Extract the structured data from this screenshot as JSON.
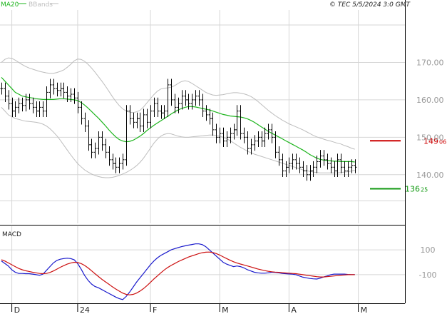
{
  "header": {
    "legend_ma": "MA20",
    "legend_bb": "BBands",
    "copyright": "© TEC 5/5/2024 3:0 GMT"
  },
  "colors": {
    "price_bar": "#000000",
    "ma": "#1db51d",
    "bbands": "#bdbdbd",
    "grid": "#d6d6d6",
    "resistance": "#cc0000",
    "support": "#119911",
    "macd": "#1a1acc",
    "signal": "#cc1111",
    "axis_text": "#999999"
  },
  "chart_data": [
    {
      "type": "ohlc",
      "y_ticks": [
        {
          "value": 170,
          "label": "170.00"
        },
        {
          "value": 160,
          "label": "160.00"
        },
        {
          "value": 150,
          "label": "150.00"
        },
        {
          "value": 140,
          "label": "140.00"
        }
      ],
      "ylim": [
        127,
        184
      ],
      "x_ticks": [
        {
          "index": 3,
          "label": "D"
        },
        {
          "index": 22,
          "label": "24"
        },
        {
          "index": 43,
          "label": "F"
        },
        {
          "index": 63,
          "label": "M"
        },
        {
          "index": 83,
          "label": "A"
        },
        {
          "index": 103,
          "label": "M"
        }
      ],
      "levels": [
        {
          "name": "resistance",
          "value": 149.06,
          "label_main": "149",
          "label_frac": "06"
        },
        {
          "name": "support",
          "value": 136.25,
          "label_main": "136",
          "label_frac": "25"
        }
      ],
      "close": [
        163.0,
        161.0,
        159.0,
        157.0,
        158.0,
        159.0,
        158.5,
        160.0,
        159.0,
        158.0,
        157.0,
        158.0,
        157.0,
        162.0,
        164.0,
        163.0,
        162.5,
        163.0,
        162.0,
        161.0,
        161.5,
        160.5,
        158.0,
        155.0,
        153.0,
        148.0,
        146.0,
        147.0,
        150.0,
        148.0,
        146.0,
        144.0,
        143.0,
        142.0,
        143.0,
        144.0,
        157.0,
        155.0,
        154.0,
        155.0,
        153.0,
        156.0,
        154.0,
        157.0,
        159.0,
        157.0,
        156.5,
        157.0,
        164.0,
        160.0,
        158.0,
        159.0,
        161.0,
        160.0,
        159.0,
        160.0,
        161.0,
        160.0,
        157.0,
        156.0,
        155.0,
        152.0,
        150.0,
        151.0,
        149.0,
        150.0,
        151.0,
        152.0,
        157.0,
        151.0,
        150.0,
        147.0,
        148.0,
        149.0,
        150.0,
        149.0,
        151.0,
        152.0,
        150.0,
        146.0,
        144.0,
        141.0,
        142.0,
        143.0,
        144.0,
        143.0,
        142.0,
        141.0,
        140.0,
        141.0,
        142.0,
        143.5,
        145.0,
        144.0,
        143.0,
        142.0,
        141.0,
        144.0,
        142.0,
        141.0,
        142.0,
        142.5,
        142.0
      ],
      "ma20": [
        166.0,
        165.0,
        164.0,
        163.0,
        162.0,
        161.5,
        161.0,
        160.8,
        160.6,
        160.5,
        160.3,
        160.2,
        160.1,
        160.1,
        160.1,
        160.1,
        160.2,
        160.3,
        160.3,
        160.2,
        160.1,
        160.0,
        159.8,
        159.3,
        158.6,
        157.8,
        156.9,
        156.0,
        155.1,
        154.1,
        153.1,
        152.0,
        151.0,
        150.1,
        149.4,
        149.0,
        148.8,
        148.9,
        149.2,
        149.7,
        150.3,
        151.0,
        151.8,
        152.5,
        153.2,
        153.8,
        154.4,
        155.0,
        155.6,
        156.2,
        156.8,
        157.3,
        157.7,
        158.0,
        158.2,
        158.2,
        158.1,
        157.9,
        157.7,
        157.5,
        157.3,
        157.0,
        156.7,
        156.4,
        156.1,
        155.9,
        155.7,
        155.6,
        155.5,
        155.4,
        155.2,
        154.9,
        154.5,
        154.0,
        153.4,
        152.8,
        152.2,
        151.6,
        151.1,
        150.6,
        150.1,
        149.6,
        149.1,
        148.6,
        148.1,
        147.6,
        147.1,
        146.6,
        146.0,
        145.4,
        144.9,
        144.4,
        144.1,
        143.9,
        143.8,
        143.7,
        143.6,
        143.6,
        143.5,
        143.5,
        143.5,
        143.5,
        143.4
      ],
      "bb_upper": [
        170.0,
        170.8,
        171.2,
        171.1,
        170.6,
        170.0,
        169.4,
        168.9,
        168.5,
        168.2,
        167.9,
        167.6,
        167.4,
        167.2,
        167.1,
        167.1,
        167.3,
        167.6,
        168.0,
        168.7,
        169.5,
        170.4,
        170.9,
        170.8,
        170.3,
        169.5,
        168.5,
        167.4,
        166.2,
        165.0,
        163.7,
        162.3,
        160.9,
        159.6,
        158.5,
        157.6,
        157.0,
        156.7,
        156.6,
        156.8,
        157.2,
        158.1,
        159.2,
        160.3,
        161.4,
        162.3,
        162.9,
        163.1,
        163.2,
        163.4,
        163.8,
        164.4,
        164.9,
        165.1,
        164.9,
        164.4,
        163.8,
        163.2,
        162.6,
        162.0,
        161.6,
        161.3,
        161.2,
        161.3,
        161.4,
        161.6,
        161.8,
        161.9,
        161.9,
        161.8,
        161.6,
        161.3,
        160.9,
        160.3,
        159.6,
        158.8,
        158.0,
        157.2,
        156.5,
        155.8,
        155.2,
        154.6,
        154.1,
        153.6,
        153.2,
        152.8,
        152.4,
        152.0,
        151.5,
        151.0,
        150.5,
        150.1,
        149.8,
        149.5,
        149.2,
        149.0,
        148.7,
        148.4,
        148.2,
        147.8,
        147.5,
        147.1,
        146.8
      ],
      "bb_lower": [
        158.0,
        157.0,
        156.0,
        155.5,
        155.0,
        154.8,
        154.5,
        154.3,
        154.2,
        154.1,
        154.0,
        153.8,
        153.5,
        153.0,
        152.3,
        151.4,
        150.4,
        149.2,
        147.9,
        146.6,
        145.3,
        144.1,
        143.0,
        142.1,
        141.3,
        140.7,
        140.2,
        139.8,
        139.5,
        139.3,
        139.2,
        139.2,
        139.3,
        139.5,
        139.8,
        140.2,
        140.6,
        141.1,
        141.7,
        142.4,
        143.3,
        144.4,
        145.7,
        147.1,
        148.4,
        149.5,
        150.3,
        150.8,
        151.0,
        150.9,
        150.6,
        150.3,
        150.1,
        150.0,
        150.0,
        150.1,
        150.2,
        150.3,
        150.4,
        150.5,
        150.6,
        150.6,
        150.5,
        150.3,
        150.0,
        149.6,
        149.1,
        148.5,
        147.9,
        147.3,
        146.8,
        146.3,
        145.9,
        145.5,
        145.2,
        144.9,
        144.6,
        144.3,
        144.0,
        143.7,
        143.4,
        143.1,
        142.8,
        142.5,
        142.2,
        141.9,
        141.6,
        141.3,
        141.1,
        140.9,
        140.7,
        140.6,
        140.5,
        140.5,
        140.5,
        140.5,
        140.5,
        140.5,
        140.6,
        140.7,
        140.8,
        141.0,
        141.2
      ]
    },
    {
      "type": "line",
      "title": "MACD",
      "y_ticks": [
        {
          "value": 100,
          "label": "100"
        },
        {
          "value": -100,
          "label": "-100"
        }
      ],
      "ylim": [
        -330,
        290
      ],
      "series": [
        {
          "name": "macd",
          "values": [
            10,
            -10,
            -30,
            -60,
            -80,
            -90,
            -90,
            -92,
            -92,
            -95,
            -100,
            -105,
            -95,
            -65,
            -35,
            -5,
            15,
            25,
            30,
            33,
            30,
            20,
            -10,
            -55,
            -105,
            -145,
            -175,
            -195,
            -205,
            -220,
            -235,
            -250,
            -265,
            -280,
            -292,
            -300,
            -275,
            -240,
            -200,
            -160,
            -125,
            -90,
            -55,
            -20,
            10,
            35,
            55,
            70,
            85,
            100,
            110,
            118,
            126,
            132,
            138,
            143,
            148,
            148,
            142,
            125,
            100,
            75,
            50,
            25,
            0,
            -15,
            -25,
            -35,
            -30,
            -35,
            -45,
            -60,
            -70,
            -80,
            -85,
            -88,
            -88,
            -85,
            -80,
            -82,
            -85,
            -90,
            -92,
            -94,
            -96,
            -100,
            -110,
            -120,
            -125,
            -130,
            -133,
            -135,
            -128,
            -118,
            -110,
            -100,
            -95,
            -95,
            -95,
            -95,
            -98,
            -100,
            -100
          ]
        },
        {
          "name": "signal",
          "values": [
            20,
            10,
            -5,
            -20,
            -35,
            -50,
            -60,
            -68,
            -74,
            -80,
            -85,
            -90,
            -92,
            -90,
            -82,
            -70,
            -55,
            -40,
            -27,
            -15,
            -6,
            0,
            -2,
            -10,
            -25,
            -45,
            -68,
            -92,
            -115,
            -137,
            -157,
            -177,
            -197,
            -215,
            -232,
            -248,
            -258,
            -262,
            -258,
            -248,
            -232,
            -212,
            -188,
            -162,
            -135,
            -110,
            -85,
            -62,
            -42,
            -25,
            -10,
            5,
            18,
            30,
            42,
            52,
            61,
            70,
            77,
            81,
            82,
            78,
            70,
            58,
            44,
            30,
            16,
            4,
            -6,
            -14,
            -22,
            -30,
            -38,
            -46,
            -54,
            -61,
            -67,
            -72,
            -76,
            -79,
            -81,
            -84,
            -86,
            -88,
            -90,
            -92,
            -96,
            -100,
            -104,
            -108,
            -112,
            -116,
            -118,
            -118,
            -116,
            -113,
            -110,
            -107,
            -104,
            -102,
            -100,
            -100,
            -100
          ]
        }
      ]
    }
  ]
}
